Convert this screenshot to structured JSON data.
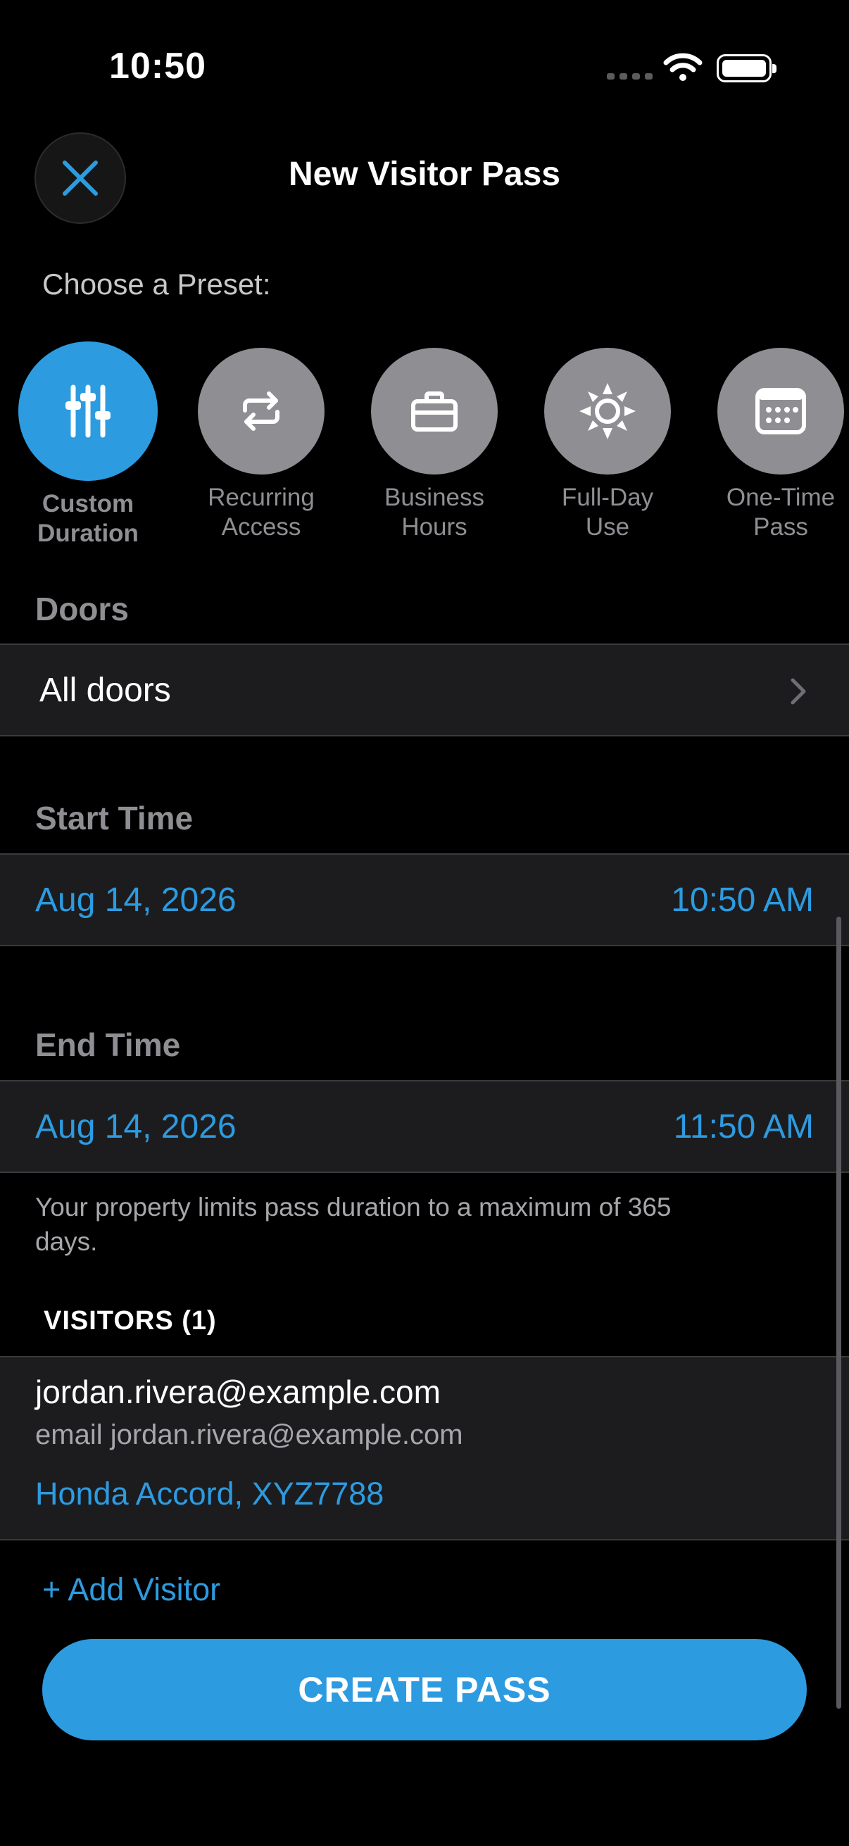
{
  "status_bar": {
    "time": "10:50"
  },
  "header": {
    "title": "New Visitor Pass",
    "close_icon": "close-x-icon"
  },
  "presets": {
    "label": "Choose a Preset:",
    "items": [
      {
        "label_line1": "Custom",
        "label_line2": "Duration",
        "icon": "sliders-icon",
        "selected": true
      },
      {
        "label_line1": "Recurring",
        "label_line2": "Access",
        "icon": "repeat-icon",
        "selected": false
      },
      {
        "label_line1": "Business",
        "label_line2": "Hours",
        "icon": "briefcase-icon",
        "selected": false
      },
      {
        "label_line1": "Full-Day",
        "label_line2": "Use",
        "icon": "sun-icon",
        "selected": false
      },
      {
        "label_line1": "One-Time",
        "label_line2": "Pass",
        "icon": "calendar-icon",
        "selected": false
      }
    ]
  },
  "doors": {
    "label": "Doors",
    "value": "All doors"
  },
  "start_time": {
    "label": "Start Time",
    "date": "Aug 14, 2026",
    "time": "10:50 AM"
  },
  "end_time": {
    "label": "End Time",
    "date": "Aug 14, 2026",
    "time": "11:50 AM"
  },
  "footnote": "Your property limits pass duration to a maximum of 365 days.",
  "visitors": {
    "header": "VISITORS (1)",
    "items": [
      {
        "name": "jordan.rivera@example.com",
        "sub_label": "email",
        "email": "jordan.rivera@example.com",
        "vehicle": "Honda Accord, XYZ7788"
      }
    ]
  },
  "add_visitor_label": "+ Add Visitor",
  "create_button_label": "CREATE PASS",
  "colors": {
    "accent": "#2d9be0",
    "inactive_circle": "#8e8e93",
    "row_bg": "#1c1c1e"
  }
}
